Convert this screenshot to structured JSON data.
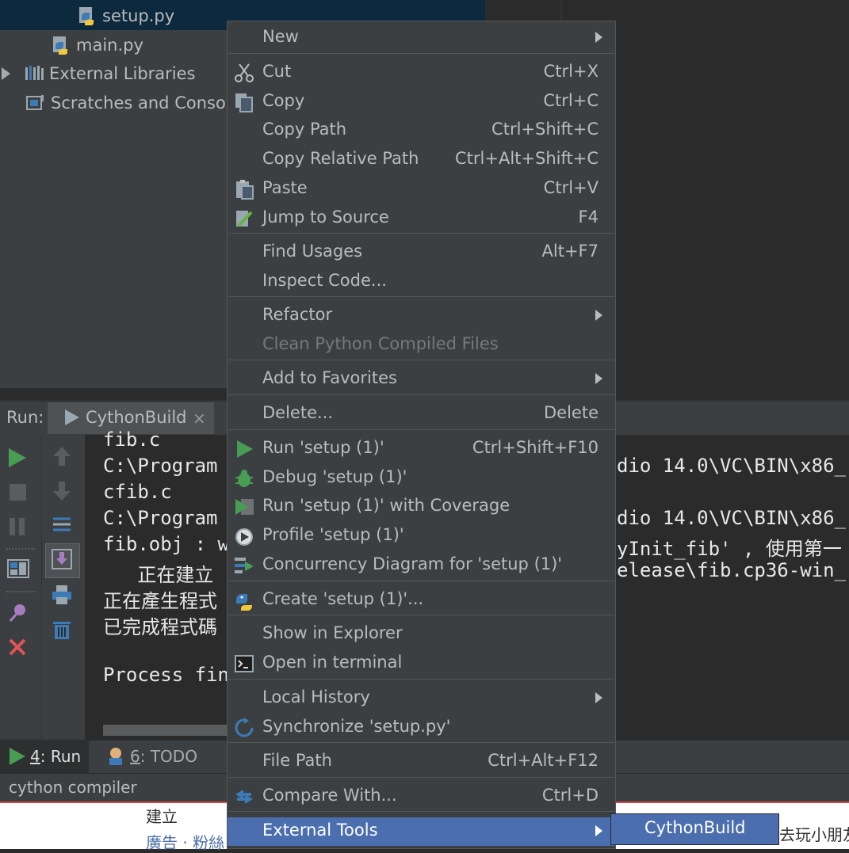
{
  "project_tree": {
    "items": [
      {
        "label": "setup.py"
      },
      {
        "label": "main.py"
      },
      {
        "label": "External Libraries"
      },
      {
        "label": "Scratches and Consoles"
      }
    ]
  },
  "run_panel": {
    "label": "Run:",
    "tab": "CythonBuild",
    "console_lines": [
      "fib.c",
      "C:\\Program",
      "cfib.c",
      "C:\\Program",
      "fib.obj : w",
      "   正在建立",
      "正在產生程式",
      "已完成程式碼",
      "",
      "Process fin"
    ],
    "console_right": [
      "dio 14.0\\VC\\BIN\\x86_",
      "dio 14.0\\VC\\BIN\\x86_",
      "yInit_fib' , 使用第一",
      "elease\\fib.cp36-win_"
    ]
  },
  "bottom_toolbar": {
    "run": {
      "num": "4",
      "label": ": Run"
    },
    "todo": {
      "num": "6",
      "label": ": TODO"
    }
  },
  "status_bar": {
    "text": "cython compiler"
  },
  "web_strip": {
    "text1": "建立",
    "text2": "廣告 · 粉絲",
    "text3": "去玩小朋友"
  },
  "context_menu": {
    "items": [
      {
        "label": "New",
        "submenu": true
      },
      {
        "label": "Cut",
        "shortcut": "Ctrl+X",
        "icon": "scissors-icon"
      },
      {
        "label": "Copy",
        "shortcut": "Ctrl+C",
        "icon": "copy-icon"
      },
      {
        "label": "Copy Path",
        "shortcut": "Ctrl+Shift+C"
      },
      {
        "label": "Copy Relative Path",
        "shortcut": "Ctrl+Alt+Shift+C"
      },
      {
        "label": "Paste",
        "shortcut": "Ctrl+V",
        "icon": "paste-icon"
      },
      {
        "label": "Jump to Source",
        "shortcut": "F4",
        "icon": "pencil-icon"
      },
      {
        "label": "Find Usages",
        "shortcut": "Alt+F7"
      },
      {
        "label": "Inspect Code..."
      },
      {
        "label": "Refactor",
        "submenu": true
      },
      {
        "label": "Clean Python Compiled Files",
        "disabled": true
      },
      {
        "label": "Add to Favorites",
        "submenu": true
      },
      {
        "label": "Delete...",
        "shortcut": "Delete"
      },
      {
        "label": "Run 'setup (1)'",
        "shortcut": "Ctrl+Shift+F10",
        "icon": "run-icon"
      },
      {
        "label": "Debug 'setup (1)'",
        "icon": "debug-bug-icon"
      },
      {
        "label": "Run 'setup (1)' with Coverage",
        "icon": "coverage-icon"
      },
      {
        "label": "Profile 'setup (1)'",
        "icon": "profile-icon"
      },
      {
        "label": "Concurrency Diagram for 'setup (1)'",
        "icon": "concurrency-icon"
      },
      {
        "label": "Create 'setup (1)'...",
        "icon": "python-icon"
      },
      {
        "label": "Show in Explorer"
      },
      {
        "label": "Open in terminal",
        "icon": "terminal-icon"
      },
      {
        "label": "Local History",
        "submenu": true
      },
      {
        "label": "Synchronize 'setup.py'",
        "icon": "sync-icon"
      },
      {
        "label": "File Path",
        "shortcut": "Ctrl+Alt+F12"
      },
      {
        "label": "Compare With...",
        "shortcut": "Ctrl+D",
        "icon": "compare-icon"
      },
      {
        "label": "External Tools",
        "submenu": true,
        "highlighted": true
      }
    ],
    "submenu": {
      "label": "CythonBuild"
    }
  },
  "colors": {
    "menu_bg": "#3c3f41",
    "highlight": "#4b6eaf",
    "run_green": "#499c54",
    "close_red": "#e05555"
  }
}
